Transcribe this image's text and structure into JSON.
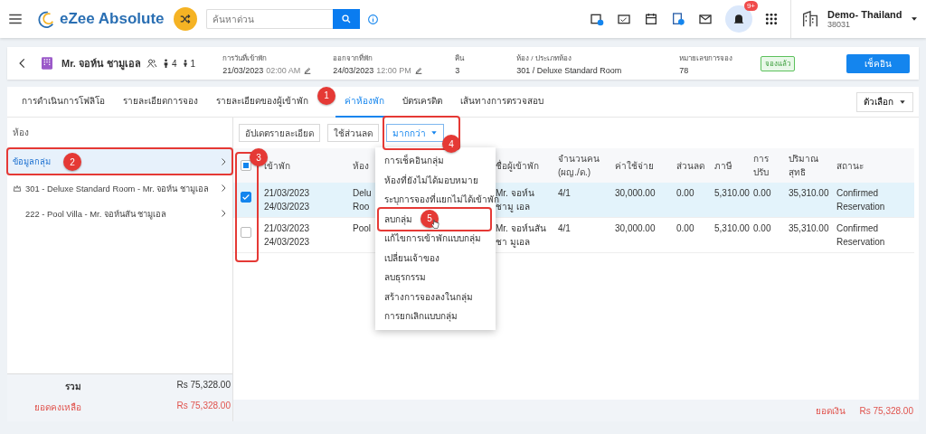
{
  "topbar": {
    "logo": "eZee Absolute",
    "search": {
      "placeholder": "ค้นหาด่วน"
    },
    "notification_badge": "9+",
    "property": {
      "name": "Demo- Thailand",
      "code": "38031"
    }
  },
  "guest": {
    "name": "Mr. จอห์น ชามูเอล",
    "adults": "4",
    "children": "1",
    "fields": [
      {
        "label": "การวันที่เข้าพัก",
        "value": "21/03/2023",
        "time": "02:00 AM"
      },
      {
        "label": "ออกจากที่พัก",
        "value": "24/03/2023",
        "time": "12:00 PM"
      },
      {
        "label": "คืน",
        "value": "3"
      },
      {
        "label": "ห้อง / ประเภทห้อง",
        "value": "301 / Deluxe Standard Room"
      },
      {
        "label": "หมายเลขการจอง",
        "value": "78"
      }
    ],
    "status_tag": "จองแล้ว",
    "action": "เช็คอิน"
  },
  "tabs": [
    {
      "label": "การดำเนินการโฟลิโอ",
      "selected": false
    },
    {
      "label": "รายละเอียดการจอง",
      "selected": false
    },
    {
      "label": "รายละเอียดของผู้เข้าพัก",
      "selected": false
    },
    {
      "label": "ค่าห้องพัก",
      "selected": true,
      "callout": "1"
    },
    {
      "label": "บัตรเครดิต",
      "selected": false
    },
    {
      "label": "เส้นทางการตรวจสอบ",
      "selected": false
    }
  ],
  "options_button": "ตัวเลือก",
  "sidebar": {
    "title": "ห้อง",
    "items": [
      {
        "label": "ข้อมูลกลุ่ม",
        "selected": true,
        "kind": "group",
        "callout": "2"
      },
      {
        "label": "301 - Deluxe Standard Room - Mr. จอห์น ชามูเอล",
        "selected": false,
        "kind": "master"
      },
      {
        "label": "222 - Pool Villa - Mr. จอห์นสัน ชามูเอล",
        "selected": false,
        "kind": "room"
      }
    ],
    "totals": [
      {
        "label": "รวม",
        "value": "Rs 75,328.00",
        "kind": "total"
      },
      {
        "label": "ยอดคงเหลือ",
        "value": "Rs 75,328.00",
        "kind": "balance"
      }
    ]
  },
  "toolbar": [
    {
      "label": "อัปเดตรายละเอียด",
      "kind": "plain"
    },
    {
      "label": "ใช้ส่วนลด",
      "kind": "plain"
    },
    {
      "label": "มากกว่า",
      "kind": "dropdown",
      "callout": "4"
    }
  ],
  "menu": {
    "items": [
      {
        "label": "การเช็คอินกลุ่ม"
      },
      {
        "label": "ห้องที่ยังไม่ได้มอบหมาย"
      },
      {
        "label": "ระบุการจองที่แยกไม่ได้เข้าพัก"
      },
      {
        "label": "ลบกลุ่ม",
        "callout": "5"
      },
      {
        "label": "แก้ไขการเข้าพักแบบกลุ่ม"
      },
      {
        "label": "เปลี่ยนเจ้าของ"
      },
      {
        "label": "ลบธุรกรรม"
      },
      {
        "label": "สร้างการจองลงในกลุ่ม"
      },
      {
        "label": "การยกเลิกแบบกลุ่ม"
      }
    ]
  },
  "table": {
    "select_all_indeterminate": true,
    "checkbox_callout": "3",
    "columns": [
      "เข้าพัก",
      "ห้อง",
      "ชื่อผู้เข้าพัก",
      "จำนวนคน (ผญ./ด.)",
      "ค่าใช้จ่าย",
      "ส่วนลด",
      "ภาษี",
      "การ ปรับ",
      "ปริมาณ สุทธิ",
      "สถานะ"
    ],
    "rows": [
      {
        "selected": true,
        "cells": [
          [
            "21/03/2023",
            "24/03/2023"
          ],
          [
            "Delu",
            "Roo"
          ],
          [
            "Mr. จอห์น ชามู เอล"
          ],
          [
            "4/1"
          ],
          [
            "30,000.00"
          ],
          [
            "0.00"
          ],
          [
            "5,310.00"
          ],
          [
            "0.00"
          ],
          [
            "35,310.00"
          ],
          [
            "Confirmed Reservation"
          ]
        ]
      },
      {
        "selected": false,
        "cells": [
          [
            "21/03/2023",
            "24/03/2023"
          ],
          [
            "Pool"
          ],
          [
            "Mr. จอห์นสัน ชา มูเอล"
          ],
          [
            "4/1"
          ],
          [
            "30,000.00"
          ],
          [
            "0.00"
          ],
          [
            "5,310.00"
          ],
          [
            "0.00"
          ],
          [
            "35,310.00"
          ],
          [
            "Confirmed Reservation"
          ]
        ]
      }
    ]
  },
  "footer": {
    "label": "ยอดเงิน",
    "value": "Rs 75,328.00"
  }
}
